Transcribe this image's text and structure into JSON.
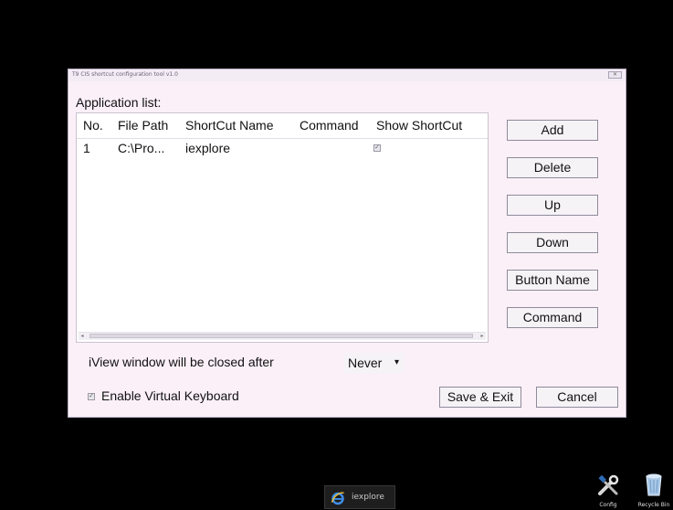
{
  "dialog": {
    "title": "T9 CIS shortcut configuration tool v1.0",
    "close_label": "✕",
    "app_list_label": "Application list:",
    "columns": [
      "No.",
      "File Path",
      "ShortCut Name",
      "Command",
      "Show ShortCut"
    ],
    "rows": [
      {
        "no": "1",
        "file_path": "C:\\Pro...",
        "shortcut_name": "iexplore",
        "command": "",
        "show_shortcut": true
      }
    ],
    "buttons": {
      "add": "Add",
      "delete": "Delete",
      "up": "Up",
      "down": "Down",
      "button_name": "Button Name",
      "command": "Command",
      "save_exit": "Save & Exit",
      "cancel": "Cancel"
    },
    "closed_after_label": "iView window will be closed after",
    "closed_after_value": "Never",
    "virtual_keyboard_label": "Enable Virtual Keyboard",
    "virtual_keyboard_checked": true
  },
  "taskbar": {
    "item_label": "iexplore",
    "item_icon": "ie-icon"
  },
  "desktop": {
    "config_label": "Config",
    "recycle_label": "Recycle Bin"
  },
  "colors": {
    "background": "#000000",
    "dialog_bg": "#fbf0f8",
    "ie_blue": "#2a7ad6"
  }
}
